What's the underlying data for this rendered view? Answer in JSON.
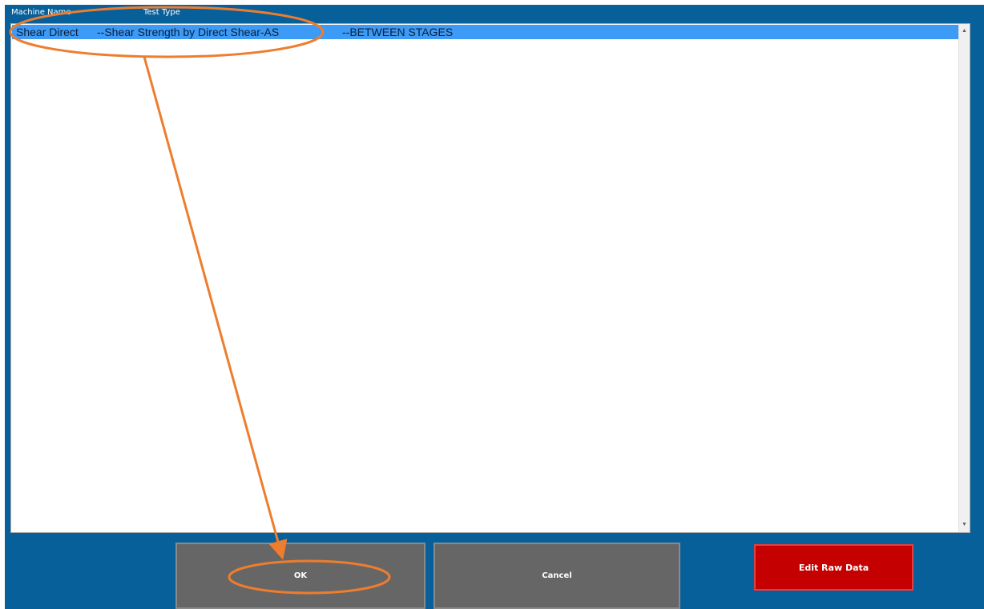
{
  "list": {
    "headers": {
      "machine_name": "Machine Name",
      "test_type": "Test Type"
    },
    "rows": [
      {
        "machine": "Shear Direct",
        "test": "--Shear Strength by Direct Shear-AS",
        "stage": "--BETWEEN STAGES",
        "selected": true
      }
    ]
  },
  "buttons": {
    "ok": "OK",
    "cancel": "Cancel",
    "edit_raw": "Edit Raw Data"
  },
  "colors": {
    "frame": "#08609b",
    "selection": "#3d9af5",
    "gray_button": "#666666",
    "red_button": "#c50000",
    "annotation": "#ee7d2e"
  },
  "icons": {
    "scroll_up": "chevron-up-icon",
    "scroll_down": "chevron-down-icon"
  }
}
